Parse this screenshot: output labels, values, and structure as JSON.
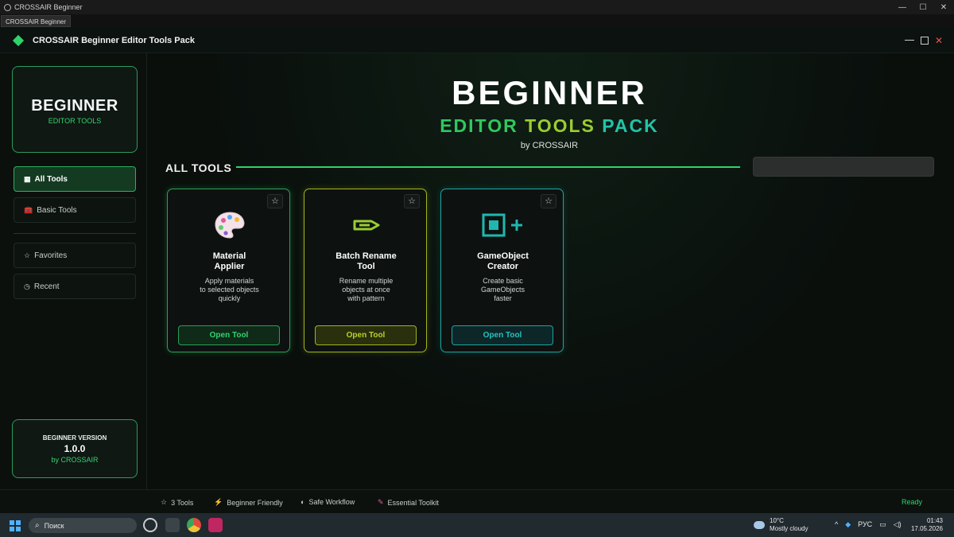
{
  "os": {
    "window_title": "CROSSAIR Beginner",
    "tab_label": "CROSSAIR Beginner",
    "min_glyph": "—",
    "max_glyph": "☐",
    "close_glyph": "✕"
  },
  "header": {
    "title": "CROSSAIR Beginner Editor Tools Pack",
    "close_glyph": "✕"
  },
  "sidebar": {
    "brand_title": "BEGINNER",
    "brand_sub": "EDITOR TOOLS",
    "items": [
      {
        "icon": "▦",
        "label": "All Tools",
        "active": true
      },
      {
        "icon": "🧰",
        "label": "Basic Tools",
        "active": false
      },
      {
        "icon": "☆",
        "label": "Favorites",
        "active": false
      },
      {
        "icon": "◷",
        "label": "Recent",
        "active": false
      }
    ],
    "version_label": "BEGINNER VERSION",
    "version_number": "1.0.0",
    "version_by": "by CROSSAIR"
  },
  "hero": {
    "title": "BEGINNER",
    "sub_1": "EDITOR",
    "sub_2": "TOOLS",
    "sub_3": "PACK",
    "by": "by CROSSAIR"
  },
  "section": {
    "title": "ALL TOOLS",
    "search_value": "",
    "search_placeholder": ""
  },
  "tools": [
    {
      "title_line1": "Material",
      "title_line2": "Applier",
      "desc_1": "Apply materials",
      "desc_2": "to selected objects",
      "desc_3": "quickly",
      "button": "Open Tool",
      "icon": "palette-icon",
      "star": "☆"
    },
    {
      "title_line1": "Batch Rename",
      "title_line2": "Tool",
      "desc_1": "Rename multiple",
      "desc_2": "objects at once",
      "desc_3": "with pattern",
      "button": "Open Tool",
      "icon": "pencil-icon",
      "star": "☆"
    },
    {
      "title_line1": "GameObject",
      "title_line2": "Creator",
      "desc_1": "Create basic",
      "desc_2": "GameObjects",
      "desc_3": "faster",
      "button": "Open Tool",
      "icon": "add-square-icon",
      "star": "☆"
    }
  ],
  "status": {
    "items": [
      {
        "icon": "☆",
        "label": "3 Tools"
      },
      {
        "icon": "⚡",
        "label": "Beginner Friendly"
      },
      {
        "icon": "◐",
        "label": "Safe Workflow"
      },
      {
        "icon": "✎",
        "label": "Essential Toolkit"
      }
    ],
    "ready": "Ready"
  },
  "taskbar": {
    "search_label": "Поиск",
    "weather_temp": "10°C",
    "weather_desc": "Mostly cloudy",
    "lang": "РУС",
    "time": "01:43",
    "date": "17.05.2026"
  },
  "colors": {
    "accent_green": "#2ed46a",
    "accent_lime": "#a0b51d",
    "accent_teal": "#1fa3a0"
  }
}
